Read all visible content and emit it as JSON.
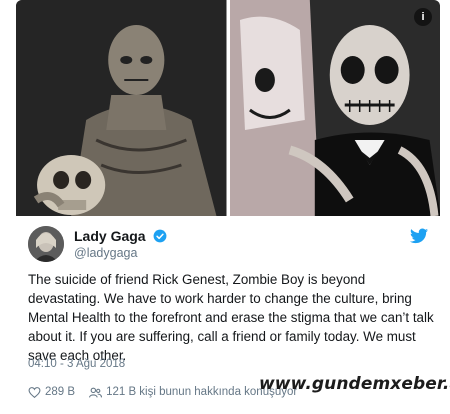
{
  "tweet": {
    "display_name": "Lady Gaga",
    "handle": "@ladygaga",
    "text": "The suicide of friend Rick Genest, Zombie Boy is beyond devastating. We have to work harder to change the culture, bring Mental Health to the forefront and erase the stigma that we can’t talk about it. If you are suffering, call a friend or family today. We must save each other.",
    "timestamp": "04:10 - 3 Ağu 2018",
    "likes": "289 B",
    "retweets_label": "121 B kişi bunun hakkında konuşuyor",
    "media_badge": "i"
  },
  "watermark": "www.gundemxeber.az",
  "icons": {
    "verified": "verified-badge-icon",
    "brand": "twitter-bird-icon",
    "like": "heart-icon",
    "people": "people-icon",
    "info": "info-icon"
  },
  "colors": {
    "twitter_blue": "#1da1f2",
    "text": "#14171a",
    "muted": "#657786"
  }
}
